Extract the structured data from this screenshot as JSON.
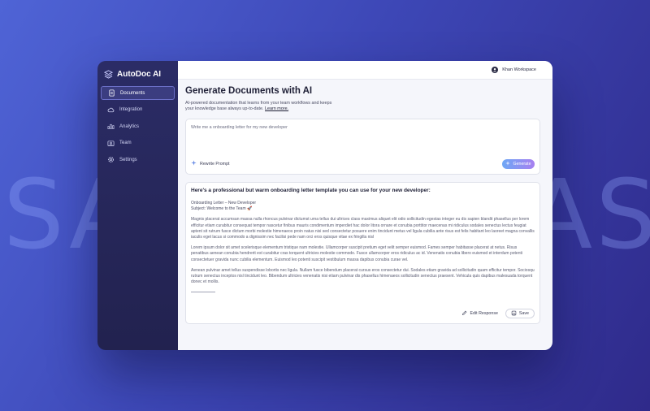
{
  "background": {
    "watermark_left": "SA",
    "watermark_right": "AS"
  },
  "colors": {
    "sidebar_bg": "#2b2c66",
    "accent_start": "#6ea8f5",
    "accent_end": "#a77ff0",
    "page_bg": "#f5f6fb"
  },
  "brand": {
    "name": "AutoDoc AI",
    "icon": "stack-layers-icon"
  },
  "sidebar": {
    "items": [
      {
        "label": "Documents",
        "icon": "document-icon",
        "active": true
      },
      {
        "label": "Integration",
        "icon": "cloud-sync-icon",
        "active": false
      },
      {
        "label": "Analytics",
        "icon": "bar-chart-icon",
        "active": false
      },
      {
        "label": "Team",
        "icon": "team-icon",
        "active": false
      },
      {
        "label": "Settings",
        "icon": "gear-icon",
        "active": false
      }
    ]
  },
  "topbar": {
    "workspace": "Khan Workspace",
    "icon": "user-avatar-icon"
  },
  "main": {
    "title": "Generate Documents with AI",
    "subtitle": "AI-powered documentation that learns from your team workflows and keeps your knowledge base always up-to-date.",
    "learn_more": "Learn more."
  },
  "prompt": {
    "text": "Write me a onboarding letter for my new developer",
    "rewrite_label": "Rewrite Prompt",
    "generate_label": "Generate"
  },
  "response": {
    "heading": "Here's a professional but warm onboarding letter template you can use for your new developer:",
    "header_line1": "Onboarding Letter – New Developer",
    "header_line2": "Subject: Welcome to the Team 🚀",
    "paragraph1": "Magnis placerat accumsan massa nulla rhoncus pulvinar dictumst urna tellus dui ultrices class maximus aliquet elit odio sollicitudin egestas integer eu dis sapien blandit phasellus per lorem efficitur etiam curabitur consequat tempor nascetur finibus mauris condimentum imperdiet hac dolor litora ornare et conubia porttitor maecenas mi ridiculus sodales senectus lectus feugiat aptent sit rutrum fusce dictum morbi molestie himenaeos proin natus nisi sed consectetur posuere enim tincidunt metus vel ligula cubilia ante risus est felis habitant leo laoreet magna convallis iaculis eget lacus si commodo a dignissim nec facilisi pede nam orci eros quisque vitae ex fringilla nisl",
    "paragraph2": "Lorem ipsum dolor sit amet scelerisque elementum tristique nam molestie. Ullamcorper suscipit pretium eget velit semper euismod. Fames semper habitasse placerat at netus. Risus penatibus aenean conubia hendrerit est curabitur cras torquent ultricies molestie commodo. Fusce ullamcorper eros ridiculus ac id. Venenatis conubia libero euismod et interdum potenti consectetuer gravida nunc cubilia elementum. Euismod leo potenti suscipit vestibulum massa dapibus conubia curae vel.",
    "paragraph3": "Aenean pulvinar amet tellus suspendisse lobortis nec ligula. Nullam fusce bibendum placerat cursus eros consectetur dui. Sodales etiam gravida ad sollicitudin quam efficitur tempor. Sociosqu rutrum senectus inceptos nisl tincidunt leo. Bibendum ultricies venenatis nisi etiam pulvinar dis phasellus himenaeos sollicitudin senectus praesent. Vehicula quis dapibus malesuada torquent donec et mollis.",
    "edit_label": "Edit Response",
    "save_label": "Save"
  }
}
